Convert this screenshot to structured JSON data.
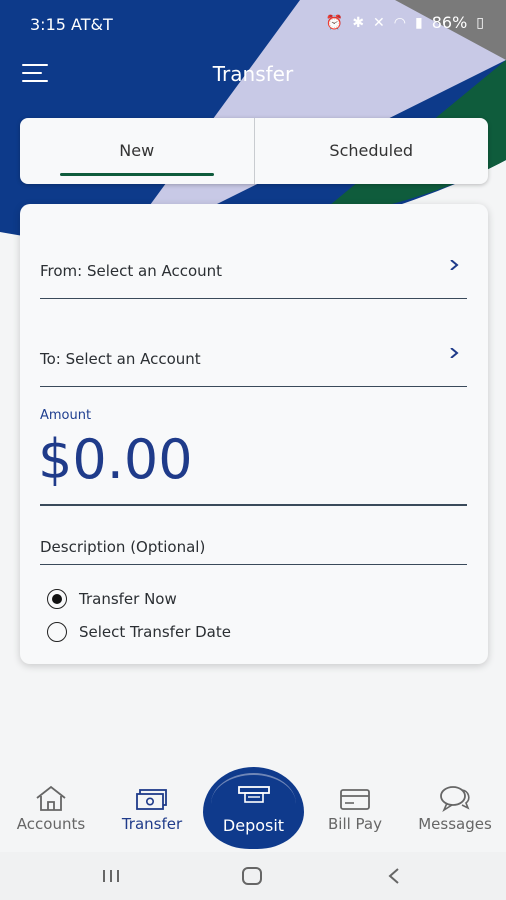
{
  "status_bar": {
    "time": "3:15 AT&T",
    "battery": "86%"
  },
  "app_bar": {
    "title": "Transfer"
  },
  "tabs": [
    {
      "label": "New",
      "active": true
    },
    {
      "label": "Scheduled",
      "active": false
    }
  ],
  "form": {
    "from_label": "From: Select an Account",
    "to_label": "To: Select an Account",
    "amount_label": "Amount",
    "amount_value": "$0.00",
    "description_placeholder": "Description (Optional)",
    "timing_options": [
      {
        "label": "Transfer Now",
        "selected": true
      },
      {
        "label": "Select Transfer Date",
        "selected": false
      }
    ]
  },
  "bottom_nav": {
    "items": [
      {
        "label": "Accounts",
        "icon": "home-icon"
      },
      {
        "label": "Transfer",
        "icon": "money-icon",
        "active": true
      },
      {
        "label": "Deposit",
        "icon": "check-deposit-icon"
      },
      {
        "label": "Bill Pay",
        "icon": "wallet-icon"
      },
      {
        "label": "Messages",
        "icon": "chat-bubbles-icon"
      }
    ]
  },
  "colors": {
    "brand_blue": "#0f3a8c",
    "brand_green": "#0f5c3c",
    "accent_lavender": "#c8c9e6"
  }
}
